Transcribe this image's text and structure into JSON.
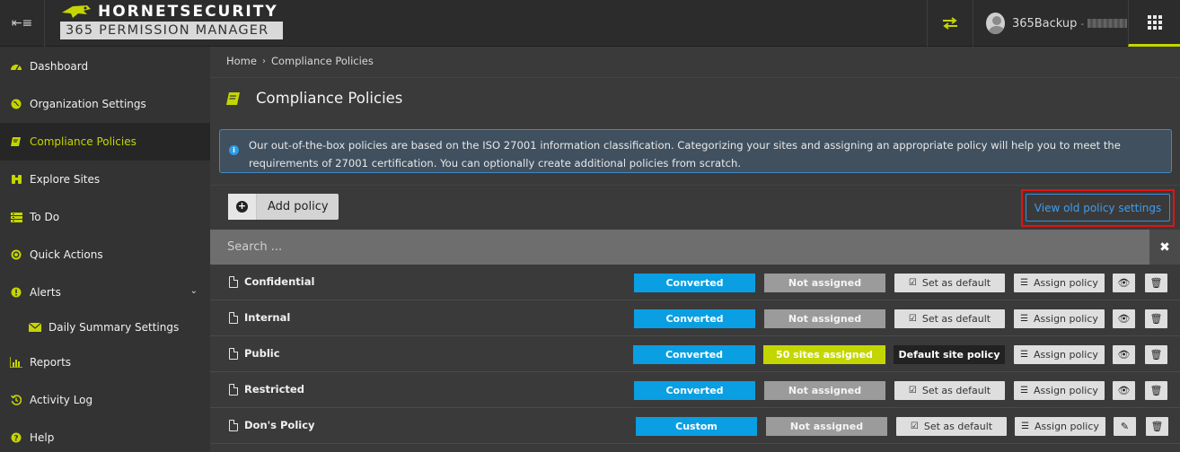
{
  "brand": {
    "name": "HORNETSECURITY",
    "product": "365 PERMISSION MANAGER"
  },
  "user": {
    "name": "365Backup"
  },
  "sidebar": {
    "items": [
      {
        "label": "Dashboard",
        "icon": "dashboard-icon"
      },
      {
        "label": "Organization Settings",
        "icon": "globe-icon"
      },
      {
        "label": "Compliance Policies",
        "icon": "book-icon"
      },
      {
        "label": "Explore Sites",
        "icon": "binoculars-icon"
      },
      {
        "label": "To Do",
        "icon": "list-icon"
      },
      {
        "label": "Quick Actions",
        "icon": "target-icon"
      },
      {
        "label": "Alerts",
        "icon": "alert-icon"
      },
      {
        "label": "Daily Summary Settings",
        "icon": "envelope-icon"
      },
      {
        "label": "Reports",
        "icon": "bar-chart-icon"
      },
      {
        "label": "Activity Log",
        "icon": "history-icon"
      },
      {
        "label": "Help",
        "icon": "help-icon"
      }
    ]
  },
  "breadcrumb": {
    "home": "Home",
    "current": "Compliance Policies"
  },
  "page": {
    "title": "Compliance Policies",
    "info_line1": "Our out-of-the-box policies are based on the ISO 27001 information classification. Categorizing your sites and assigning an appropriate policy will help you to meet the",
    "info_line2": "requirements of 27001 certification. You can optionally create additional policies from scratch."
  },
  "toolbar": {
    "add_label": "Add policy",
    "old_settings_label": "View old policy settings",
    "search_placeholder": "Search ..."
  },
  "policies": [
    {
      "name": "Confidential",
      "status": "Converted",
      "assigned": "Not assigned",
      "default": "Set as default",
      "assign": "Assign policy",
      "extra": "eye"
    },
    {
      "name": "Internal",
      "status": "Converted",
      "assigned": "Not assigned",
      "default": "Set as default",
      "assign": "Assign policy",
      "extra": "eye"
    },
    {
      "name": "Public",
      "status": "Converted",
      "assigned": "50 sites assigned",
      "default": "Default site policy",
      "assign": "Assign policy",
      "extra": "eye"
    },
    {
      "name": "Restricted",
      "status": "Converted",
      "assigned": "Not assigned",
      "default": "Set as default",
      "assign": "Assign policy",
      "extra": "eye"
    },
    {
      "name": "Don's Policy",
      "status": "Custom",
      "assigned": "Not assigned",
      "default": "Set as default",
      "assign": "Assign policy",
      "extra": "pencil"
    }
  ],
  "colors": {
    "accent": "#c4d600",
    "status_blue": "#0a9fe3",
    "link_blue": "#3d9df0",
    "highlight_red": "#e01414"
  }
}
